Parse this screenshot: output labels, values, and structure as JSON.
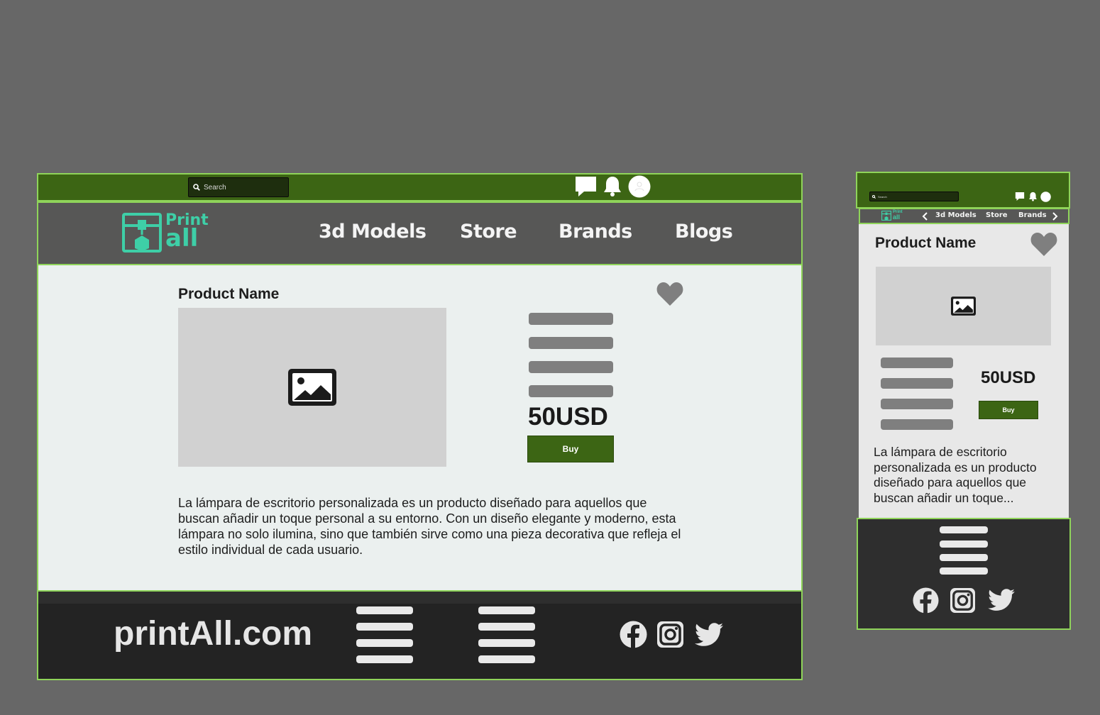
{
  "colors": {
    "accent_green": "#3c6514",
    "border_green": "#8fd45a",
    "nav_bg": "#575756",
    "footer_bg": "#232323",
    "logo_teal": "#3ecfa7"
  },
  "desktop": {
    "search": {
      "placeholder": "Search",
      "icon": "search-icon"
    },
    "header_icons": [
      "chat-icon",
      "bell-icon",
      "user-avatar-icon"
    ],
    "logo": {
      "line1": "Print",
      "line2": "all"
    },
    "nav": {
      "models": "3d Models",
      "store": "Store",
      "brands": "Brands",
      "blogs": "Blogs"
    },
    "product": {
      "name": "Product Name",
      "price": "50USD",
      "buy_label": "Buy",
      "description": "La lámpara de escritorio personalizada es un producto diseñado para aquellos que buscan añadir un toque personal a su entorno. Con un diseño elegante y moderno, esta lámpara no solo ilumina, sino que también sirve como una pieza decorativa que refleja el estilo individual de cada usuario."
    },
    "footer": {
      "site": "printAll.com",
      "social": [
        "facebook-icon",
        "instagram-icon",
        "twitter-icon"
      ]
    }
  },
  "mobile": {
    "search": {
      "placeholder": "Search"
    },
    "logo": {
      "line1": "Print",
      "line2": "all"
    },
    "nav": {
      "models": "3d Models",
      "store": "Store",
      "brands": "Brands"
    },
    "product": {
      "name": "Product Name",
      "price": "50USD",
      "buy_label": "Buy",
      "description": "La lámpara de escritorio personalizada es un producto diseñado para aquellos que buscan añadir un toque..."
    }
  }
}
